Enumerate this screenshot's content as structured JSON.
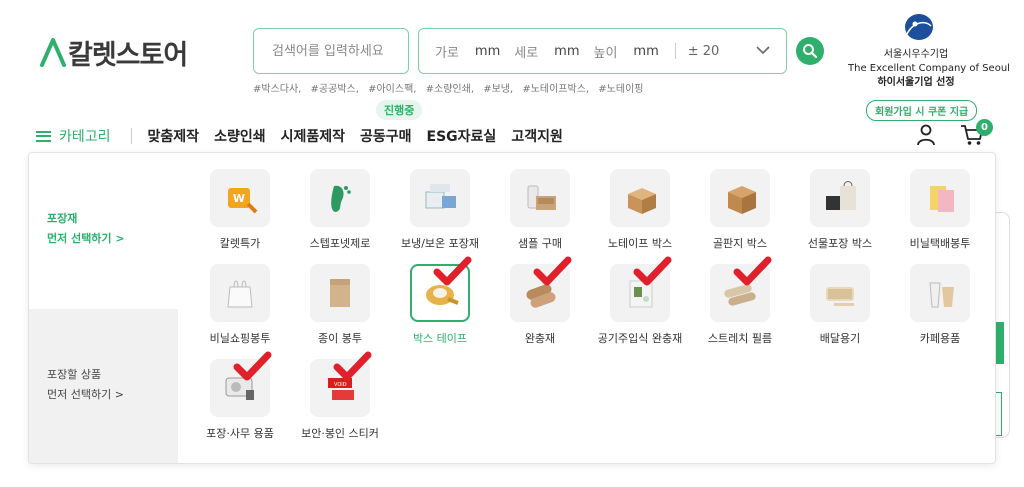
{
  "header": {
    "logo_text": "칼렛스토어",
    "search_placeholder": "검색어를 입력하세요",
    "size": {
      "width_label": "가로",
      "depth_label": "세로",
      "height_label": "높이",
      "unit": "mm",
      "tolerance": "± 20"
    },
    "hashtags": [
      "#박스다사,",
      "#공공박스,",
      "#아이스팩,",
      "#소량인쇄,",
      "#보냉,",
      "#노테이프박스,",
      "#노테이핑"
    ],
    "award": {
      "line1": "서울시우수기업",
      "line2": "The Excellent Company of Seoul",
      "line3": "하이서울기업 선정"
    }
  },
  "nav": {
    "category_label": "카테고리",
    "items": [
      "맞춤제작",
      "소량인쇄",
      "시제품제작",
      "공동구매",
      "ESG자료실",
      "고객지원"
    ],
    "in_progress_badge": "진행중",
    "coupon_badge": "회원가입 시 쿠폰 지급",
    "cart_count": "0"
  },
  "panel": {
    "side_a": {
      "line1": "포장재",
      "line2": "먼저 선택하기 >"
    },
    "side_b": {
      "line1": "포장할 상품",
      "line2": "먼저 선택하기 >"
    },
    "items": [
      {
        "label": "칼렛특가",
        "icon": "sale-tag-icon",
        "checked": false
      },
      {
        "label": "스텝포넷제로",
        "icon": "footprint-icon",
        "checked": false
      },
      {
        "label": "보냉/보온 포장재",
        "icon": "insulated-box-icon",
        "checked": false
      },
      {
        "label": "샘플 구매",
        "icon": "sample-pack-icon",
        "checked": false
      },
      {
        "label": "노테이프 박스",
        "icon": "no-tape-box-icon",
        "checked": false
      },
      {
        "label": "골판지 박스",
        "icon": "cardboard-box-icon",
        "checked": false
      },
      {
        "label": "선물포장 박스",
        "icon": "gift-box-icon",
        "checked": false
      },
      {
        "label": "비닐택배봉투",
        "icon": "poly-mailer-icon",
        "checked": false
      },
      {
        "label": "비닐쇼핑봉투",
        "icon": "plastic-bag-icon",
        "checked": false
      },
      {
        "label": "종이 봉투",
        "icon": "paper-envelope-icon",
        "checked": false
      },
      {
        "label": "박스 테이프",
        "icon": "box-tape-icon",
        "checked": true,
        "selected": true
      },
      {
        "label": "완충재",
        "icon": "bubble-wrap-icon",
        "checked": true
      },
      {
        "label": "공기주입식 완충재",
        "icon": "air-cushion-icon",
        "checked": true
      },
      {
        "label": "스트레치 필름",
        "icon": "stretch-film-icon",
        "checked": true
      },
      {
        "label": "배달용기",
        "icon": "food-container-icon",
        "checked": false
      },
      {
        "label": "카페용품",
        "icon": "cafe-cup-icon",
        "checked": false
      },
      {
        "label": "포장·사무 용품",
        "icon": "tape-dispenser-icon",
        "checked": true
      },
      {
        "label": "보안·봉인 스티커",
        "icon": "seal-sticker-icon",
        "checked": true
      }
    ]
  },
  "colors": {
    "brand_green": "#2eb06c",
    "light_green": "#7cd3a6",
    "check_red": "#e0202a"
  }
}
